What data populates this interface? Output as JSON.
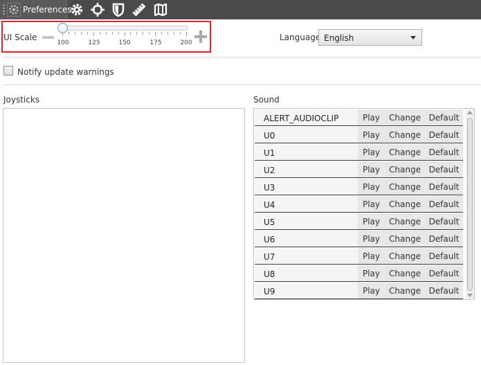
{
  "toolbar": {
    "preferences_label": "Preferences",
    "icons": [
      "gear-icon",
      "crosshair-icon",
      "shield-icon",
      "ruler-icon",
      "map-icon"
    ]
  },
  "ui_scale": {
    "label": "UI Scale",
    "min": 100,
    "max": 200,
    "value": 100,
    "tick_labels": [
      "100",
      "125",
      "150",
      "175",
      "200"
    ]
  },
  "language": {
    "label": "Language",
    "selected": "English"
  },
  "notify": {
    "label": "Notify update warnings",
    "checked": false
  },
  "joysticks": {
    "label": "Joysticks"
  },
  "sound": {
    "label": "Sound",
    "play_label": "Play",
    "change_label": "Change",
    "default_label": "Default",
    "rows": [
      "ALERT_AUDIOCLIP",
      "U0",
      "U1",
      "U2",
      "U3",
      "U4",
      "U5",
      "U6",
      "U7",
      "U8",
      "U9"
    ]
  },
  "colors": {
    "toolbar_bg": "#4a4a4a",
    "highlight_border": "#e0202a",
    "slider_thumb": "#6b9cd6"
  }
}
